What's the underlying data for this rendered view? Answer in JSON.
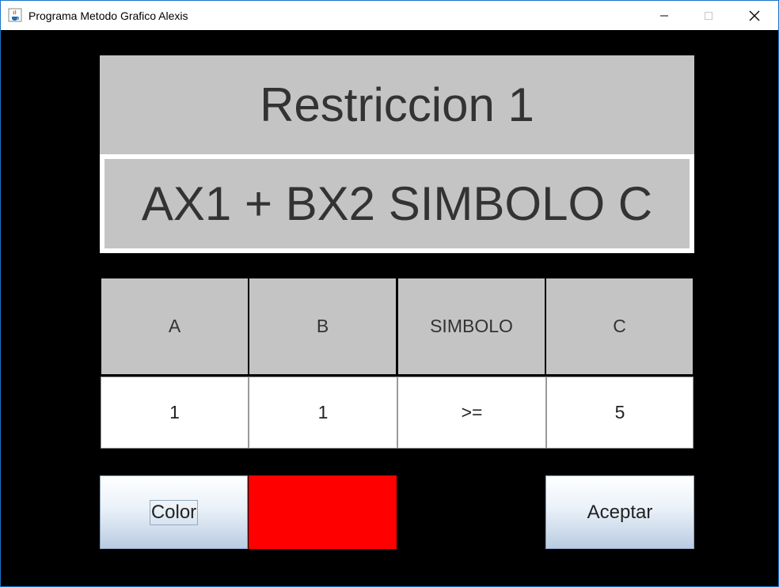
{
  "window": {
    "title": "Programa Metodo Grafico Alexis",
    "controls": {
      "minimize": "—",
      "maximize": "☐",
      "close": "✕"
    }
  },
  "panel": {
    "heading": "Restriccion 1",
    "formula": "AX1 + BX2 SIMBOLO C"
  },
  "table": {
    "headers": [
      "A",
      "B",
      "SIMBOLO",
      "C"
    ],
    "values": [
      "1",
      "1",
      ">=",
      "5"
    ]
  },
  "buttons": {
    "color_label": "Color",
    "accept_label": "Aceptar"
  },
  "colors": {
    "selected_color": "#ff0000",
    "panel_bg": "#c4c4c4",
    "window_bg": "#000000"
  },
  "icons": {
    "app": "java-coffee-icon"
  }
}
